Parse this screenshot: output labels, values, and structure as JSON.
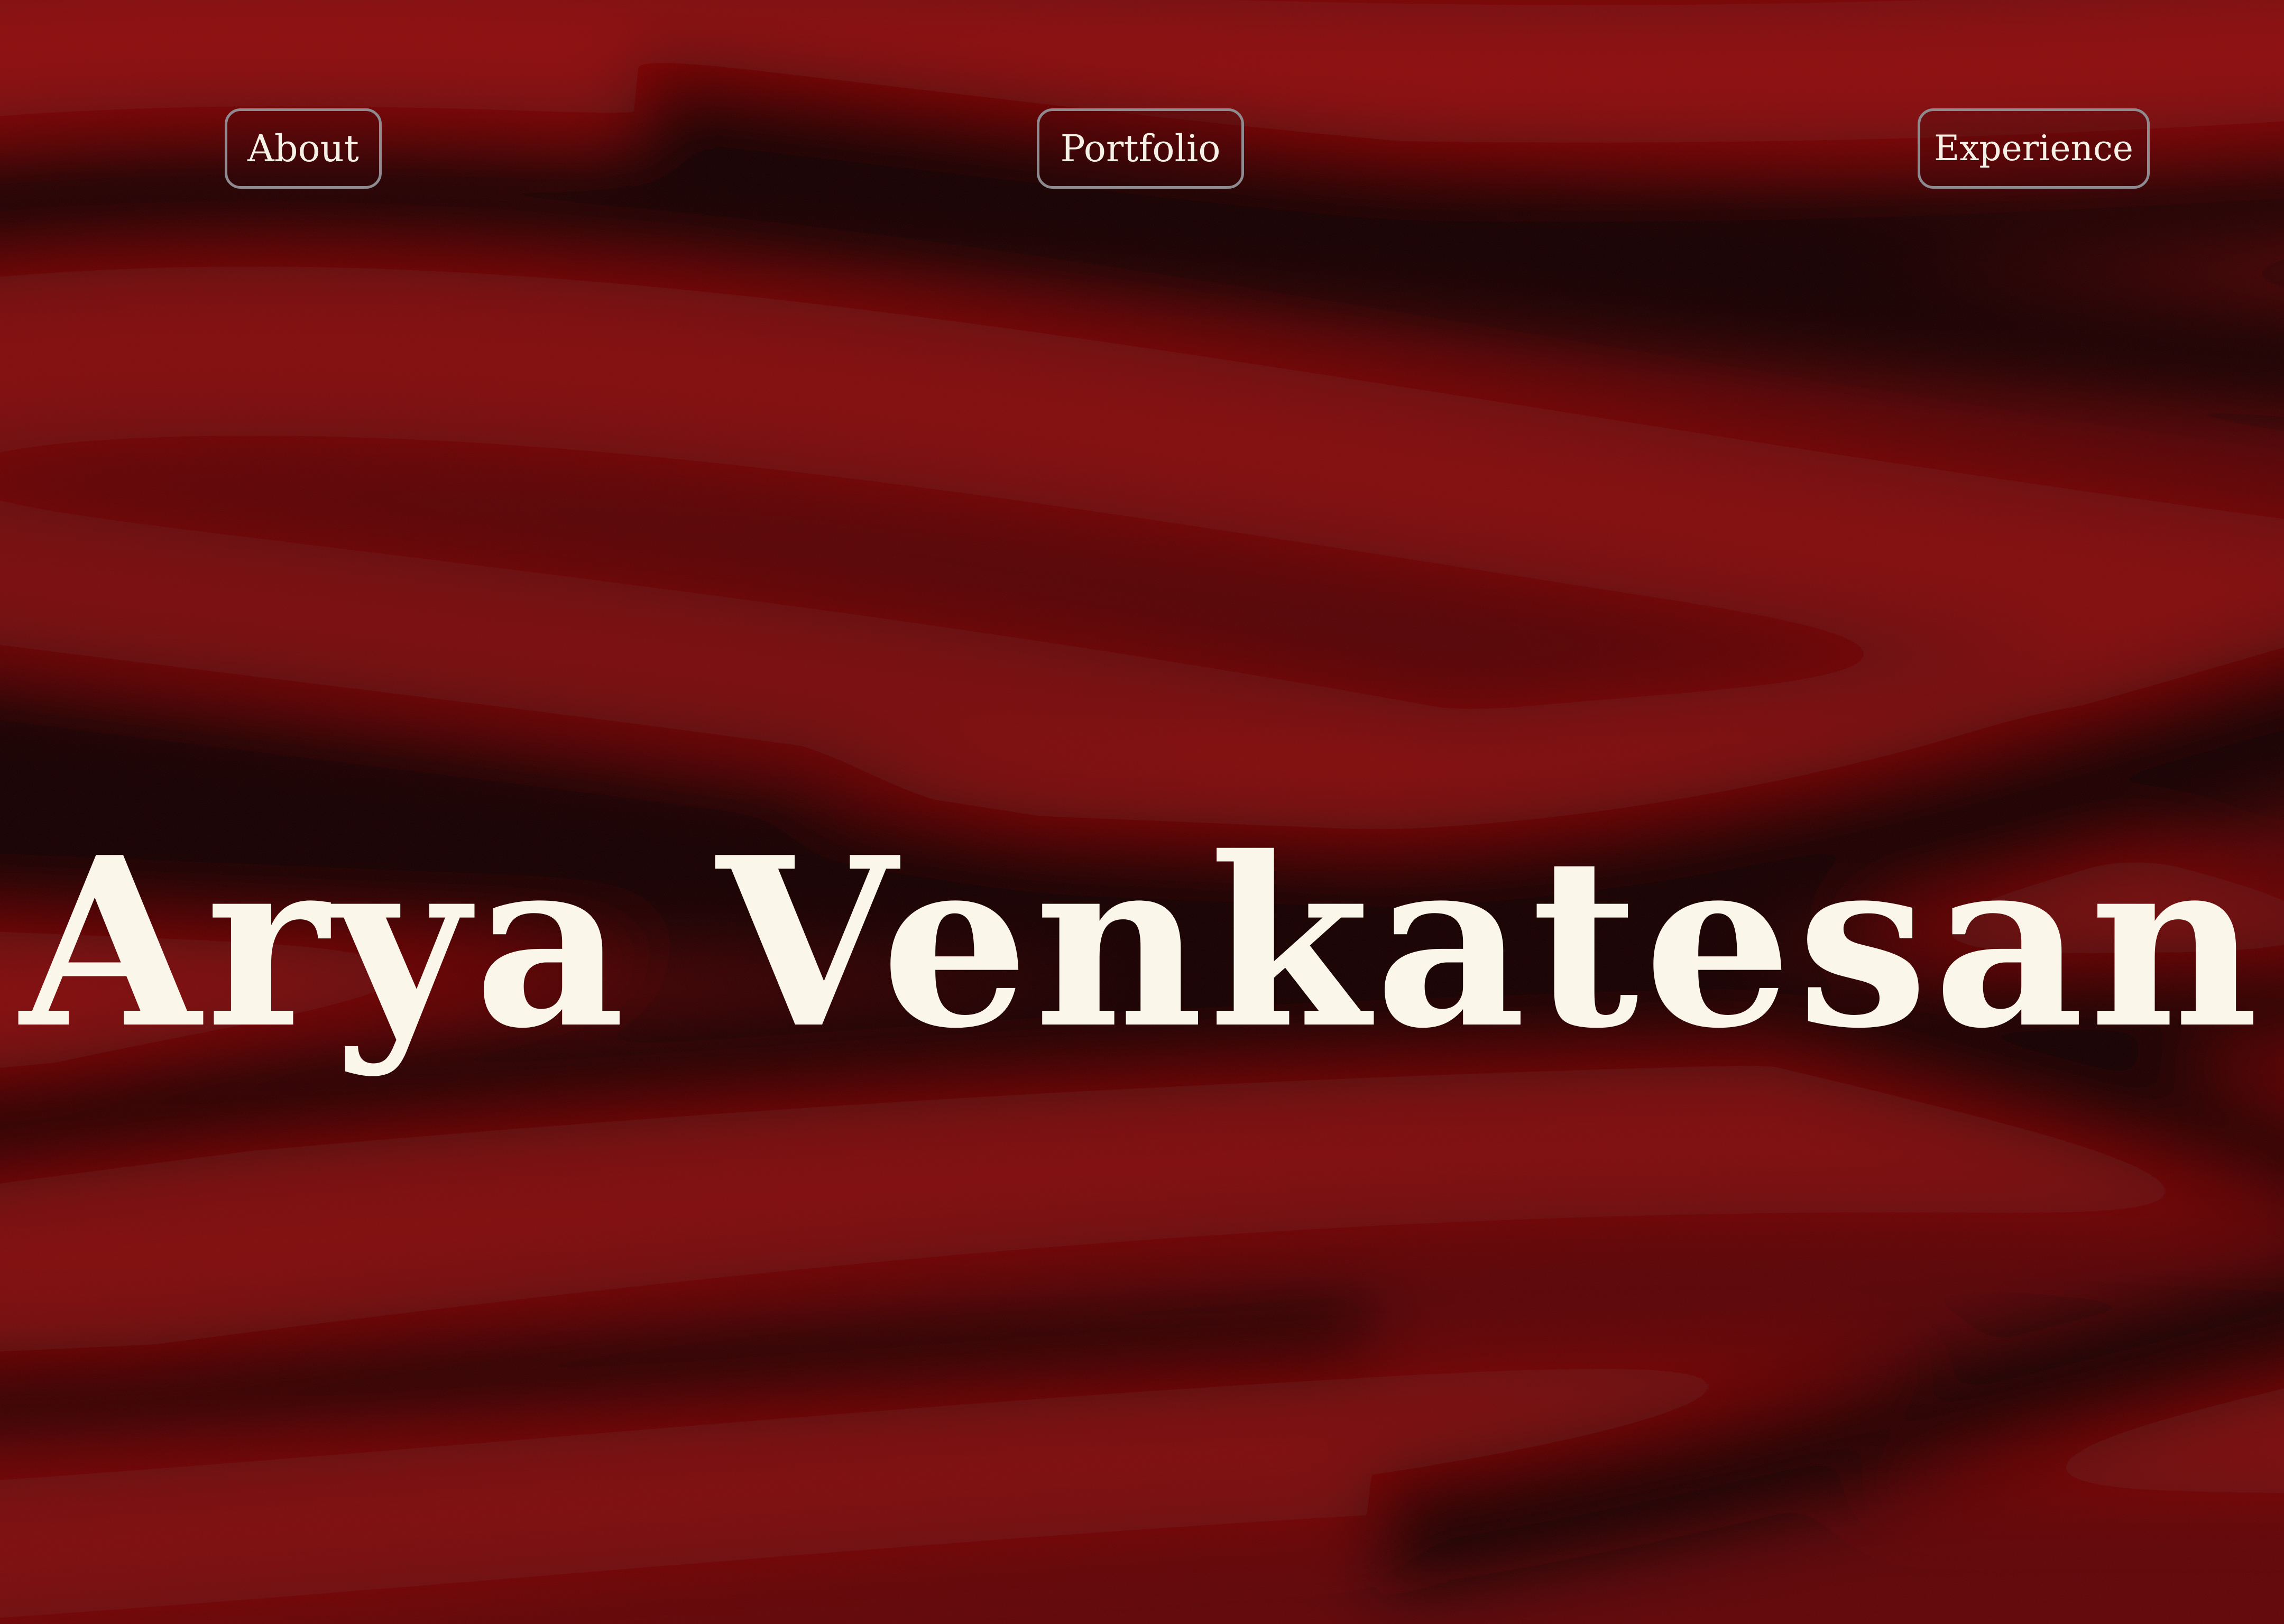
{
  "nav": {
    "about_label": "About",
    "portfolio_label": "Portfolio",
    "experience_label": "Experience"
  },
  "hero": {
    "name": "Arya Venkatesan"
  },
  "colors": {
    "background_dark": "#0c0101",
    "fabric_red": "#7a0a0c",
    "text_cream": "#f6f1e6",
    "button_border": "#8d8a90"
  }
}
